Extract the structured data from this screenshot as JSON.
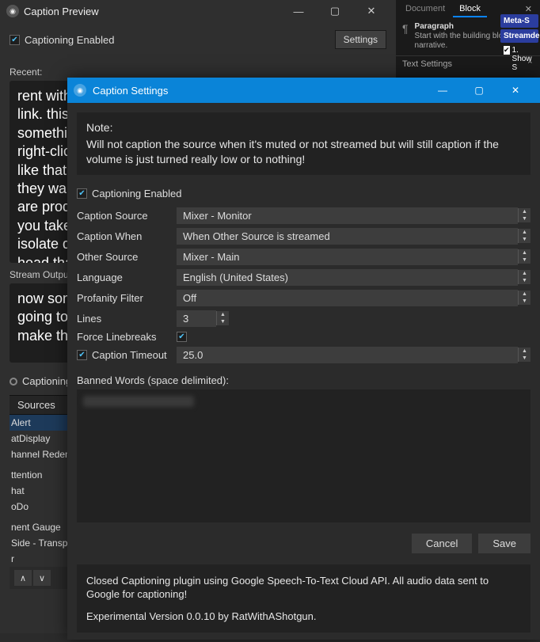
{
  "preview": {
    "title": "Caption Preview",
    "captioning_enabled_label": "Captioning Enabled",
    "settings_btn": "Settings",
    "recent_label": "Recent:",
    "recent_text": " rent with an option and a. yeah. I did .     , not, sure, and th link.  this option I think it was to do with whether something o in a new tab or in the current tab or like the right-click conte open a new tab in kaliyon, something like that. With this option Can Let users choose whether they want the link to open or not. easily copy when you are productive or not productive. attention monitor lets you take a look at the big picture. pretentious moc to isolate different sources monitor output by clicking the head that just captures everything on the screen, right? So that is a a screen capture. Yes. So this is just one. I have to. I just wa grab that code essentially and when you are having a stretch of",
    "stream_label": "Stream Output Preview (3 lines per caption):",
    "stream_text": "now sometimes if you want to take a look and see ho going to hit plus because right now it is showing the make this bigger mixer monitor. I am going to hit plu",
    "captioning_status": "Captioning"
  },
  "sources": {
    "header": "Sources",
    "items": [
      "Alert",
      "atDisplay",
      "hannel Redemptio",
      "",
      "ttention",
      "hat",
      "oDo",
      "",
      "nent Gauge",
      "Side - Transparent",
      "r"
    ]
  },
  "right": {
    "tab1": "Document",
    "tab2": "Block",
    "para_title": "Paragraph",
    "para_desc": "Start with the building block of all narrative.",
    "text_settings": "Text Settings",
    "badge1": "Meta-S",
    "badge2": "Streamde",
    "chk1": "1. Show S"
  },
  "settings": {
    "title": "Caption Settings",
    "note_title": "Note:",
    "note_body": "Will not caption the source when it's muted or not streamed but will still caption if the volume is just turned really low or to nothing!",
    "captioning_enabled_label": "Captioning Enabled",
    "rows": {
      "caption_source": {
        "label": "Caption Source",
        "value": "Mixer - Monitor"
      },
      "caption_when": {
        "label": "Caption When",
        "value": "When Other Source is streamed"
      },
      "other_source": {
        "label": "Other Source",
        "value": "Mixer - Main"
      },
      "language": {
        "label": "Language",
        "value": "English (United States)"
      },
      "profanity": {
        "label": "Profanity Filter",
        "value": "Off"
      },
      "lines": {
        "label": "Lines",
        "value": "3"
      },
      "force_linebreaks": {
        "label": "Force Linebreaks"
      },
      "caption_timeout": {
        "label": "Caption Timeout",
        "value": "25.0"
      }
    },
    "banned_label": "Banned Words (space delimited):",
    "cancel": "Cancel",
    "save": "Save",
    "info1": "Closed Captioning plugin using Google Speech-To-Text Cloud API. All audio data sent to Google for captioning!",
    "info2": "Experimental Version 0.0.10 by RatWithAShotgun."
  }
}
